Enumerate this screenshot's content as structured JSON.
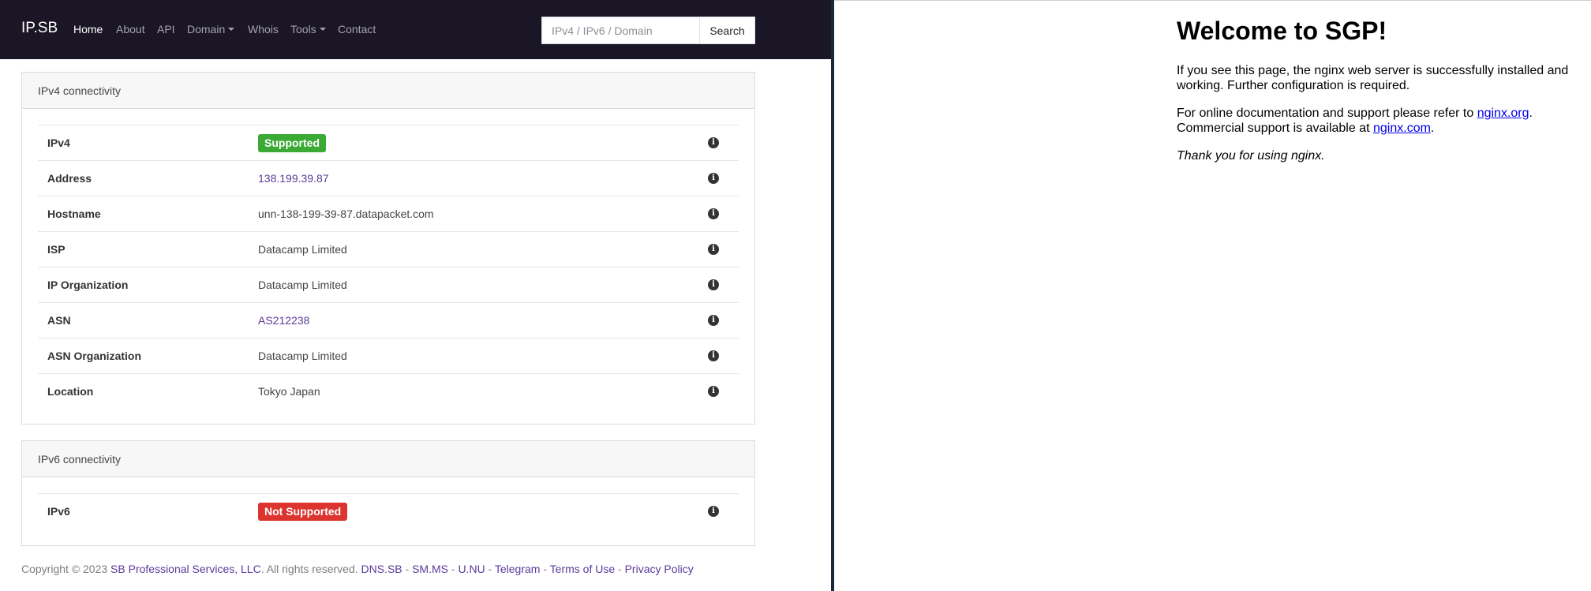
{
  "navbar": {
    "brand": "IP.SB",
    "links": [
      {
        "label": "Home"
      },
      {
        "label": "About"
      },
      {
        "label": "API"
      },
      {
        "label": "Domain"
      },
      {
        "label": "Whois"
      },
      {
        "label": "Tools"
      },
      {
        "label": "Contact"
      }
    ],
    "search_placeholder": "IPv4 / IPv6 / Domain",
    "search_button": "Search"
  },
  "ipv4": {
    "title": "IPv4 connectivity",
    "rows": [
      {
        "key": "IPv4",
        "value": "Supported"
      },
      {
        "key": "Address",
        "value": "138.199.39.87"
      },
      {
        "key": "Hostname",
        "value": "unn-138-199-39-87.datapacket.com"
      },
      {
        "key": "ISP",
        "value": "Datacamp Limited"
      },
      {
        "key": "IP Organization",
        "value": "Datacamp Limited"
      },
      {
        "key": "ASN",
        "value": "AS212238"
      },
      {
        "key": "ASN Organization",
        "value": "Datacamp Limited"
      },
      {
        "key": "Location",
        "value": "Tokyo Japan"
      }
    ]
  },
  "ipv6": {
    "title": "IPv6 connectivity",
    "rows": [
      {
        "key": "IPv6",
        "value": "Not Supported"
      }
    ]
  },
  "footer": {
    "copyright": "Copyright © 2023",
    "company": "SB Professional Services, LLC",
    "rights": ". All rights reserved.",
    "links": [
      "DNS.SB",
      "SM.MS",
      "U.NU",
      "Telegram",
      "Terms of Use",
      "Privacy Policy"
    ],
    "separator": " - "
  },
  "colors": {
    "navbar_bg": "#1a1626",
    "link": "#5a3a9a",
    "supported": "#3aaa35",
    "not_supported": "#dc3530"
  },
  "nginx": {
    "heading": "Welcome to SGP!",
    "p1": "If you see this page, the nginx web server is successfully installed and working. Further configuration is required.",
    "p2_pre": "For online documentation and support please refer to ",
    "p2_link1": "nginx.org",
    "p2_mid": ".",
    "p2_line2_pre": "Commercial support is available at ",
    "p2_link2": "nginx.com",
    "p2_end": ".",
    "p3": "Thank you for using nginx."
  }
}
